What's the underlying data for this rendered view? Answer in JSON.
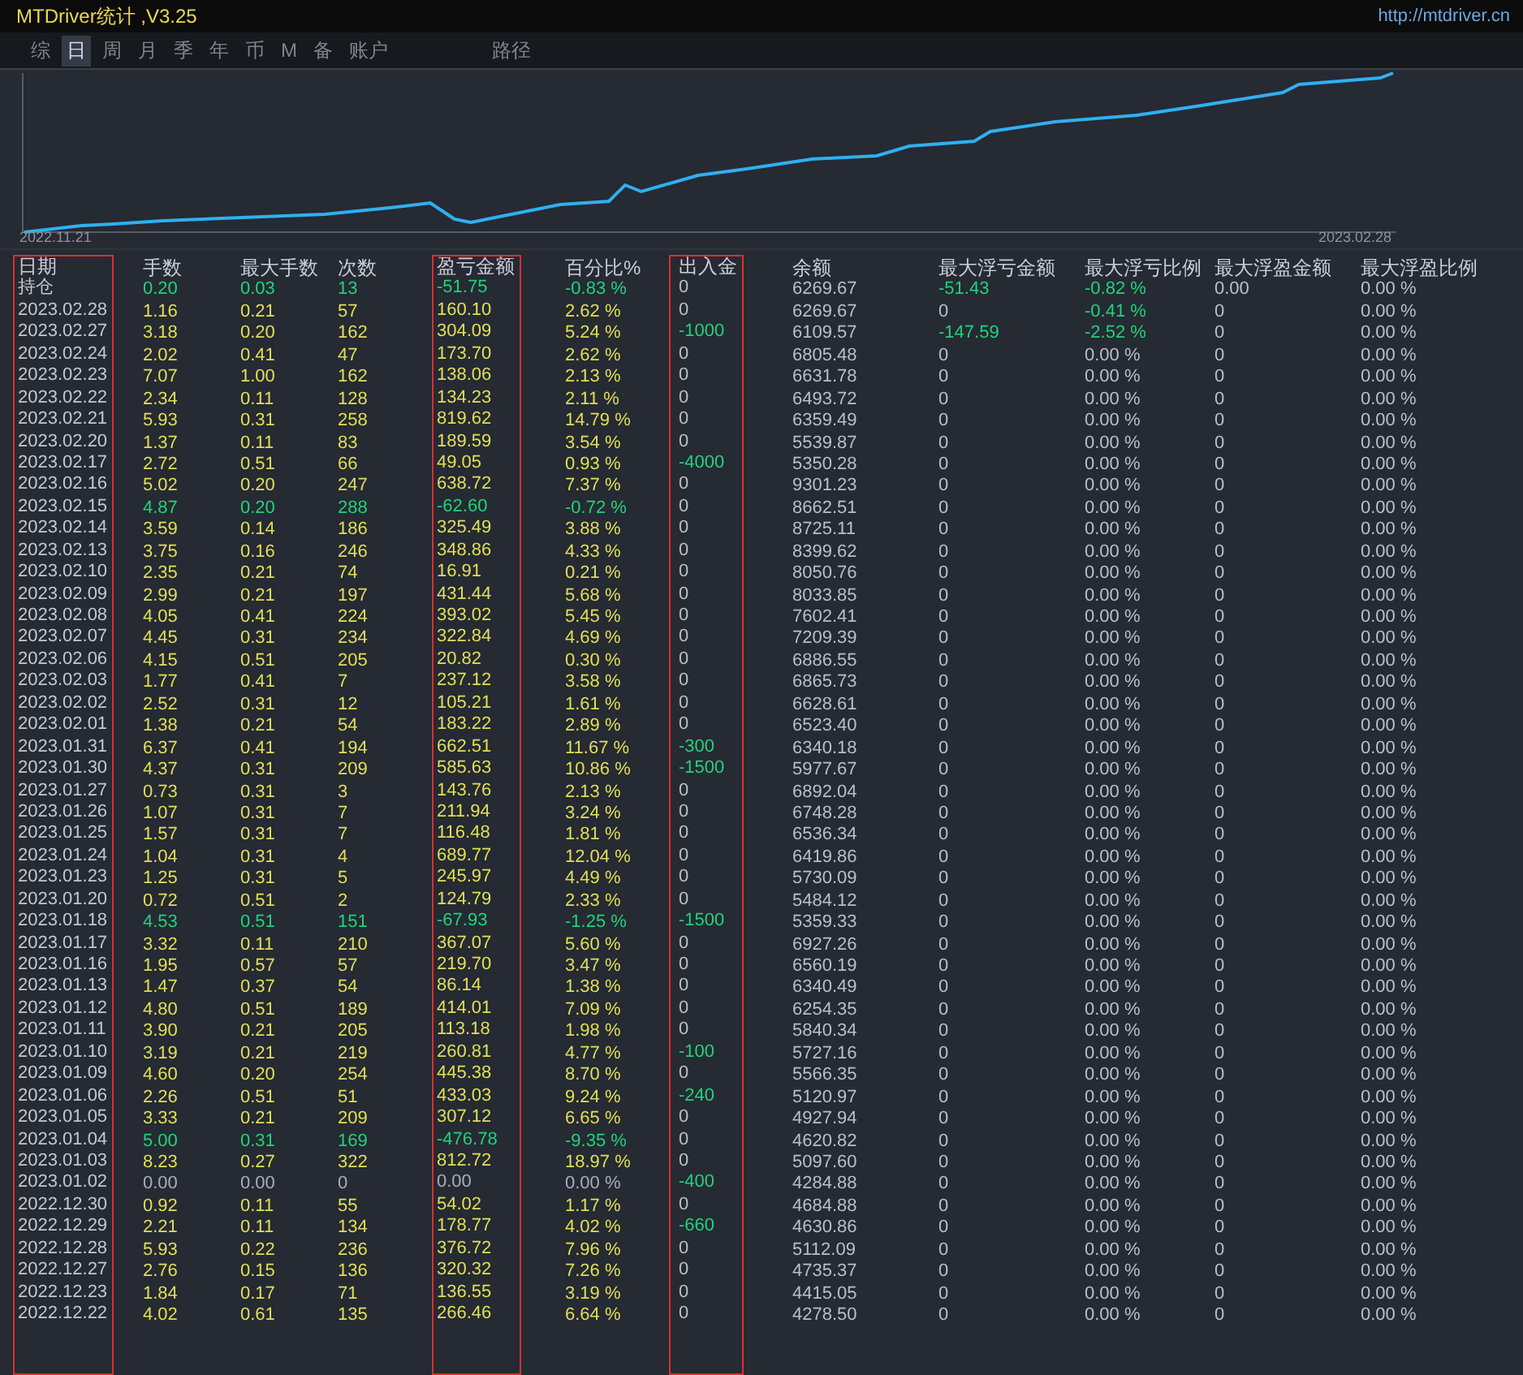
{
  "window": {
    "title": "MTDriver统计 ,V3.25",
    "link": "http://mtdriver.cn"
  },
  "tabs": [
    {
      "label": "综",
      "selected": false
    },
    {
      "label": "日",
      "selected": true
    },
    {
      "label": "周",
      "selected": false
    },
    {
      "label": "月",
      "selected": false
    },
    {
      "label": "季",
      "selected": false
    },
    {
      "label": "年",
      "selected": false
    },
    {
      "label": "币",
      "selected": false
    },
    {
      "label": "M",
      "selected": false
    },
    {
      "label": "备",
      "selected": false
    },
    {
      "label": "账户",
      "selected": false
    }
  ],
  "path_button": "路径",
  "chart": {
    "start_label": "2022.11.21",
    "end_label": "2023.02.28"
  },
  "table": {
    "columns": [
      {
        "label": "日期",
        "boxed": true
      },
      {
        "label": "手数",
        "boxed": false
      },
      {
        "label": "最大手数",
        "boxed": false
      },
      {
        "label": "次数",
        "boxed": false
      },
      {
        "label": "盈亏金额",
        "boxed": true
      },
      {
        "label": "百分比%",
        "boxed": false
      },
      {
        "label": "出入金",
        "boxed": true
      },
      {
        "label": "余额",
        "boxed": false
      },
      {
        "label": "最大浮亏金额",
        "boxed": false
      },
      {
        "label": "最大浮亏比例",
        "boxed": false
      },
      {
        "label": "最大浮盈金额",
        "boxed": false
      },
      {
        "label": "最大浮盈比例",
        "boxed": false
      }
    ],
    "rows": [
      {
        "kind": "loss",
        "cells": [
          "持仓",
          "0.20",
          "0.03",
          "13",
          "-51.75",
          "-0.83 %",
          "0",
          "6269.67",
          "-51.43",
          "-0.82 %",
          "0.00",
          "0.00 %"
        ],
        "flow_flag": false,
        "float_loss_flag": true,
        "float_pct_flag": true
      },
      {
        "kind": "gain",
        "cells": [
          "2023.02.28",
          "1.16",
          "0.21",
          "57",
          "160.10",
          "2.62 %",
          "0",
          "6269.67",
          "0",
          "-0.41 %",
          "0",
          "0.00 %"
        ],
        "flow_flag": false,
        "float_loss_flag": false,
        "float_pct_flag": true
      },
      {
        "kind": "gain",
        "cells": [
          "2023.02.27",
          "3.18",
          "0.20",
          "162",
          "304.09",
          "5.24 %",
          "-1000",
          "6109.57",
          "-147.59",
          "-2.52 %",
          "0",
          "0.00 %"
        ],
        "flow_flag": true,
        "float_loss_flag": true,
        "float_pct_flag": true
      },
      {
        "kind": "gain",
        "cells": [
          "2023.02.24",
          "2.02",
          "0.41",
          "47",
          "173.70",
          "2.62 %",
          "0",
          "6805.48",
          "0",
          "0.00 %",
          "0",
          "0.00 %"
        ],
        "flow_flag": false,
        "float_loss_flag": false,
        "float_pct_flag": false
      },
      {
        "kind": "gain",
        "cells": [
          "2023.02.23",
          "7.07",
          "1.00",
          "162",
          "138.06",
          "2.13 %",
          "0",
          "6631.78",
          "0",
          "0.00 %",
          "0",
          "0.00 %"
        ],
        "flow_flag": false,
        "float_loss_flag": false,
        "float_pct_flag": false
      },
      {
        "kind": "gain",
        "cells": [
          "2023.02.22",
          "2.34",
          "0.11",
          "128",
          "134.23",
          "2.11 %",
          "0",
          "6493.72",
          "0",
          "0.00 %",
          "0",
          "0.00 %"
        ],
        "flow_flag": false,
        "float_loss_flag": false,
        "float_pct_flag": false
      },
      {
        "kind": "gain",
        "cells": [
          "2023.02.21",
          "5.93",
          "0.31",
          "258",
          "819.62",
          "14.79 %",
          "0",
          "6359.49",
          "0",
          "0.00 %",
          "0",
          "0.00 %"
        ],
        "flow_flag": false,
        "float_loss_flag": false,
        "float_pct_flag": false
      },
      {
        "kind": "gain",
        "cells": [
          "2023.02.20",
          "1.37",
          "0.11",
          "83",
          "189.59",
          "3.54 %",
          "0",
          "5539.87",
          "0",
          "0.00 %",
          "0",
          "0.00 %"
        ],
        "flow_flag": false,
        "float_loss_flag": false,
        "float_pct_flag": false
      },
      {
        "kind": "gain",
        "cells": [
          "2023.02.17",
          "2.72",
          "0.51",
          "66",
          "49.05",
          "0.93 %",
          "-4000",
          "5350.28",
          "0",
          "0.00 %",
          "0",
          "0.00 %"
        ],
        "flow_flag": true,
        "float_loss_flag": false,
        "float_pct_flag": false
      },
      {
        "kind": "gain",
        "cells": [
          "2023.02.16",
          "5.02",
          "0.20",
          "247",
          "638.72",
          "7.37 %",
          "0",
          "9301.23",
          "0",
          "0.00 %",
          "0",
          "0.00 %"
        ],
        "flow_flag": false,
        "float_loss_flag": false,
        "float_pct_flag": false
      },
      {
        "kind": "loss",
        "cells": [
          "2023.02.15",
          "4.87",
          "0.20",
          "288",
          "-62.60",
          "-0.72 %",
          "0",
          "8662.51",
          "0",
          "0.00 %",
          "0",
          "0.00 %"
        ],
        "flow_flag": false,
        "float_loss_flag": false,
        "float_pct_flag": false
      },
      {
        "kind": "gain",
        "cells": [
          "2023.02.14",
          "3.59",
          "0.14",
          "186",
          "325.49",
          "3.88 %",
          "0",
          "8725.11",
          "0",
          "0.00 %",
          "0",
          "0.00 %"
        ],
        "flow_flag": false,
        "float_loss_flag": false,
        "float_pct_flag": false
      },
      {
        "kind": "gain",
        "cells": [
          "2023.02.13",
          "3.75",
          "0.16",
          "246",
          "348.86",
          "4.33 %",
          "0",
          "8399.62",
          "0",
          "0.00 %",
          "0",
          "0.00 %"
        ],
        "flow_flag": false,
        "float_loss_flag": false,
        "float_pct_flag": false
      },
      {
        "kind": "gain",
        "cells": [
          "2023.02.10",
          "2.35",
          "0.21",
          "74",
          "16.91",
          "0.21 %",
          "0",
          "8050.76",
          "0",
          "0.00 %",
          "0",
          "0.00 %"
        ],
        "flow_flag": false,
        "float_loss_flag": false,
        "float_pct_flag": false
      },
      {
        "kind": "gain",
        "cells": [
          "2023.02.09",
          "2.99",
          "0.21",
          "197",
          "431.44",
          "5.68 %",
          "0",
          "8033.85",
          "0",
          "0.00 %",
          "0",
          "0.00 %"
        ],
        "flow_flag": false,
        "float_loss_flag": false,
        "float_pct_flag": false
      },
      {
        "kind": "gain",
        "cells": [
          "2023.02.08",
          "4.05",
          "0.41",
          "224",
          "393.02",
          "5.45 %",
          "0",
          "7602.41",
          "0",
          "0.00 %",
          "0",
          "0.00 %"
        ],
        "flow_flag": false,
        "float_loss_flag": false,
        "float_pct_flag": false
      },
      {
        "kind": "gain",
        "cells": [
          "2023.02.07",
          "4.45",
          "0.31",
          "234",
          "322.84",
          "4.69 %",
          "0",
          "7209.39",
          "0",
          "0.00 %",
          "0",
          "0.00 %"
        ],
        "flow_flag": false,
        "float_loss_flag": false,
        "float_pct_flag": false
      },
      {
        "kind": "gain",
        "cells": [
          "2023.02.06",
          "4.15",
          "0.51",
          "205",
          "20.82",
          "0.30 %",
          "0",
          "6886.55",
          "0",
          "0.00 %",
          "0",
          "0.00 %"
        ],
        "flow_flag": false,
        "float_loss_flag": false,
        "float_pct_flag": false
      },
      {
        "kind": "gain",
        "cells": [
          "2023.02.03",
          "1.77",
          "0.41",
          "7",
          "237.12",
          "3.58 %",
          "0",
          "6865.73",
          "0",
          "0.00 %",
          "0",
          "0.00 %"
        ],
        "flow_flag": false,
        "float_loss_flag": false,
        "float_pct_flag": false
      },
      {
        "kind": "gain",
        "cells": [
          "2023.02.02",
          "2.52",
          "0.31",
          "12",
          "105.21",
          "1.61 %",
          "0",
          "6628.61",
          "0",
          "0.00 %",
          "0",
          "0.00 %"
        ],
        "flow_flag": false,
        "float_loss_flag": false,
        "float_pct_flag": false
      },
      {
        "kind": "gain",
        "cells": [
          "2023.02.01",
          "1.38",
          "0.21",
          "54",
          "183.22",
          "2.89 %",
          "0",
          "6523.40",
          "0",
          "0.00 %",
          "0",
          "0.00 %"
        ],
        "flow_flag": false,
        "float_loss_flag": false,
        "float_pct_flag": false
      },
      {
        "kind": "gain",
        "cells": [
          "2023.01.31",
          "6.37",
          "0.41",
          "194",
          "662.51",
          "11.67 %",
          "-300",
          "6340.18",
          "0",
          "0.00 %",
          "0",
          "0.00 %"
        ],
        "flow_flag": true,
        "float_loss_flag": false,
        "float_pct_flag": false
      },
      {
        "kind": "gain",
        "cells": [
          "2023.01.30",
          "4.37",
          "0.31",
          "209",
          "585.63",
          "10.86 %",
          "-1500",
          "5977.67",
          "0",
          "0.00 %",
          "0",
          "0.00 %"
        ],
        "flow_flag": true,
        "float_loss_flag": false,
        "float_pct_flag": false
      },
      {
        "kind": "gain",
        "cells": [
          "2023.01.27",
          "0.73",
          "0.31",
          "3",
          "143.76",
          "2.13 %",
          "0",
          "6892.04",
          "0",
          "0.00 %",
          "0",
          "0.00 %"
        ],
        "flow_flag": false,
        "float_loss_flag": false,
        "float_pct_flag": false
      },
      {
        "kind": "gain",
        "cells": [
          "2023.01.26",
          "1.07",
          "0.31",
          "7",
          "211.94",
          "3.24 %",
          "0",
          "6748.28",
          "0",
          "0.00 %",
          "0",
          "0.00 %"
        ],
        "flow_flag": false,
        "float_loss_flag": false,
        "float_pct_flag": false
      },
      {
        "kind": "gain",
        "cells": [
          "2023.01.25",
          "1.57",
          "0.31",
          "7",
          "116.48",
          "1.81 %",
          "0",
          "6536.34",
          "0",
          "0.00 %",
          "0",
          "0.00 %"
        ],
        "flow_flag": false,
        "float_loss_flag": false,
        "float_pct_flag": false
      },
      {
        "kind": "gain",
        "cells": [
          "2023.01.24",
          "1.04",
          "0.31",
          "4",
          "689.77",
          "12.04 %",
          "0",
          "6419.86",
          "0",
          "0.00 %",
          "0",
          "0.00 %"
        ],
        "flow_flag": false,
        "float_loss_flag": false,
        "float_pct_flag": false
      },
      {
        "kind": "gain",
        "cells": [
          "2023.01.23",
          "1.25",
          "0.31",
          "5",
          "245.97",
          "4.49 %",
          "0",
          "5730.09",
          "0",
          "0.00 %",
          "0",
          "0.00 %"
        ],
        "flow_flag": false,
        "float_loss_flag": false,
        "float_pct_flag": false
      },
      {
        "kind": "gain",
        "cells": [
          "2023.01.20",
          "0.72",
          "0.51",
          "2",
          "124.79",
          "2.33 %",
          "0",
          "5484.12",
          "0",
          "0.00 %",
          "0",
          "0.00 %"
        ],
        "flow_flag": false,
        "float_loss_flag": false,
        "float_pct_flag": false
      },
      {
        "kind": "loss",
        "cells": [
          "2023.01.18",
          "4.53",
          "0.51",
          "151",
          "-67.93",
          "-1.25 %",
          "-1500",
          "5359.33",
          "0",
          "0.00 %",
          "0",
          "0.00 %"
        ],
        "flow_flag": true,
        "float_loss_flag": false,
        "float_pct_flag": false
      },
      {
        "kind": "gain",
        "cells": [
          "2023.01.17",
          "3.32",
          "0.11",
          "210",
          "367.07",
          "5.60 %",
          "0",
          "6927.26",
          "0",
          "0.00 %",
          "0",
          "0.00 %"
        ],
        "flow_flag": false,
        "float_loss_flag": false,
        "float_pct_flag": false
      },
      {
        "kind": "gain",
        "cells": [
          "2023.01.16",
          "1.95",
          "0.57",
          "57",
          "219.70",
          "3.47 %",
          "0",
          "6560.19",
          "0",
          "0.00 %",
          "0",
          "0.00 %"
        ],
        "flow_flag": false,
        "float_loss_flag": false,
        "float_pct_flag": false
      },
      {
        "kind": "gain",
        "cells": [
          "2023.01.13",
          "1.47",
          "0.37",
          "54",
          "86.14",
          "1.38 %",
          "0",
          "6340.49",
          "0",
          "0.00 %",
          "0",
          "0.00 %"
        ],
        "flow_flag": false,
        "float_loss_flag": false,
        "float_pct_flag": false
      },
      {
        "kind": "gain",
        "cells": [
          "2023.01.12",
          "4.80",
          "0.51",
          "189",
          "414.01",
          "7.09 %",
          "0",
          "6254.35",
          "0",
          "0.00 %",
          "0",
          "0.00 %"
        ],
        "flow_flag": false,
        "float_loss_flag": false,
        "float_pct_flag": false
      },
      {
        "kind": "gain",
        "cells": [
          "2023.01.11",
          "3.90",
          "0.21",
          "205",
          "113.18",
          "1.98 %",
          "0",
          "5840.34",
          "0",
          "0.00 %",
          "0",
          "0.00 %"
        ],
        "flow_flag": false,
        "float_loss_flag": false,
        "float_pct_flag": false
      },
      {
        "kind": "gain",
        "cells": [
          "2023.01.10",
          "3.19",
          "0.21",
          "219",
          "260.81",
          "4.77 %",
          "-100",
          "5727.16",
          "0",
          "0.00 %",
          "0",
          "0.00 %"
        ],
        "flow_flag": true,
        "float_loss_flag": false,
        "float_pct_flag": false
      },
      {
        "kind": "gain",
        "cells": [
          "2023.01.09",
          "4.60",
          "0.20",
          "254",
          "445.38",
          "8.70 %",
          "0",
          "5566.35",
          "0",
          "0.00 %",
          "0",
          "0.00 %"
        ],
        "flow_flag": false,
        "float_loss_flag": false,
        "float_pct_flag": false
      },
      {
        "kind": "gain",
        "cells": [
          "2023.01.06",
          "2.26",
          "0.51",
          "51",
          "433.03",
          "9.24 %",
          "-240",
          "5120.97",
          "0",
          "0.00 %",
          "0",
          "0.00 %"
        ],
        "flow_flag": true,
        "float_loss_flag": false,
        "float_pct_flag": false
      },
      {
        "kind": "gain",
        "cells": [
          "2023.01.05",
          "3.33",
          "0.21",
          "209",
          "307.12",
          "6.65 %",
          "0",
          "4927.94",
          "0",
          "0.00 %",
          "0",
          "0.00 %"
        ],
        "flow_flag": false,
        "float_loss_flag": false,
        "float_pct_flag": false
      },
      {
        "kind": "loss",
        "cells": [
          "2023.01.04",
          "5.00",
          "0.31",
          "169",
          "-476.78",
          "-9.35 %",
          "0",
          "4620.82",
          "0",
          "0.00 %",
          "0",
          "0.00 %"
        ],
        "flow_flag": false,
        "float_loss_flag": false,
        "float_pct_flag": false
      },
      {
        "kind": "gain",
        "cells": [
          "2023.01.03",
          "8.23",
          "0.27",
          "322",
          "812.72",
          "18.97 %",
          "0",
          "5097.60",
          "0",
          "0.00 %",
          "0",
          "0.00 %"
        ],
        "flow_flag": false,
        "float_loss_flag": false,
        "float_pct_flag": false
      },
      {
        "kind": "idle",
        "cells": [
          "2023.01.02",
          "0.00",
          "0.00",
          "0",
          "0.00",
          "0.00 %",
          "-400",
          "4284.88",
          "0",
          "0.00 %",
          "0",
          "0.00 %"
        ],
        "flow_flag": true,
        "float_loss_flag": false,
        "float_pct_flag": false
      },
      {
        "kind": "gain",
        "cells": [
          "2022.12.30",
          "0.92",
          "0.11",
          "55",
          "54.02",
          "1.17 %",
          "0",
          "4684.88",
          "0",
          "0.00 %",
          "0",
          "0.00 %"
        ],
        "flow_flag": false,
        "float_loss_flag": false,
        "float_pct_flag": false
      },
      {
        "kind": "gain",
        "cells": [
          "2022.12.29",
          "2.21",
          "0.11",
          "134",
          "178.77",
          "4.02 %",
          "-660",
          "4630.86",
          "0",
          "0.00 %",
          "0",
          "0.00 %"
        ],
        "flow_flag": true,
        "float_loss_flag": false,
        "float_pct_flag": false
      },
      {
        "kind": "gain",
        "cells": [
          "2022.12.28",
          "5.93",
          "0.22",
          "236",
          "376.72",
          "7.96 %",
          "0",
          "5112.09",
          "0",
          "0.00 %",
          "0",
          "0.00 %"
        ],
        "flow_flag": false,
        "float_loss_flag": false,
        "float_pct_flag": false
      },
      {
        "kind": "gain",
        "cells": [
          "2022.12.27",
          "2.76",
          "0.15",
          "136",
          "320.32",
          "7.26 %",
          "0",
          "4735.37",
          "0",
          "0.00 %",
          "0",
          "0.00 %"
        ],
        "flow_flag": false,
        "float_loss_flag": false,
        "float_pct_flag": false
      },
      {
        "kind": "gain",
        "cells": [
          "2022.12.23",
          "1.84",
          "0.17",
          "71",
          "136.55",
          "3.19 %",
          "0",
          "4415.05",
          "0",
          "0.00 %",
          "0",
          "0.00 %"
        ],
        "flow_flag": false,
        "float_loss_flag": false,
        "float_pct_flag": false
      },
      {
        "kind": "gain",
        "cells": [
          "2022.12.22",
          "4.02",
          "0.61",
          "135",
          "266.46",
          "6.64 %",
          "0",
          "4278.50",
          "0",
          "0.00 %",
          "0",
          "0.00 %"
        ],
        "flow_flag": false,
        "float_loss_flag": false,
        "float_pct_flag": false
      }
    ]
  }
}
